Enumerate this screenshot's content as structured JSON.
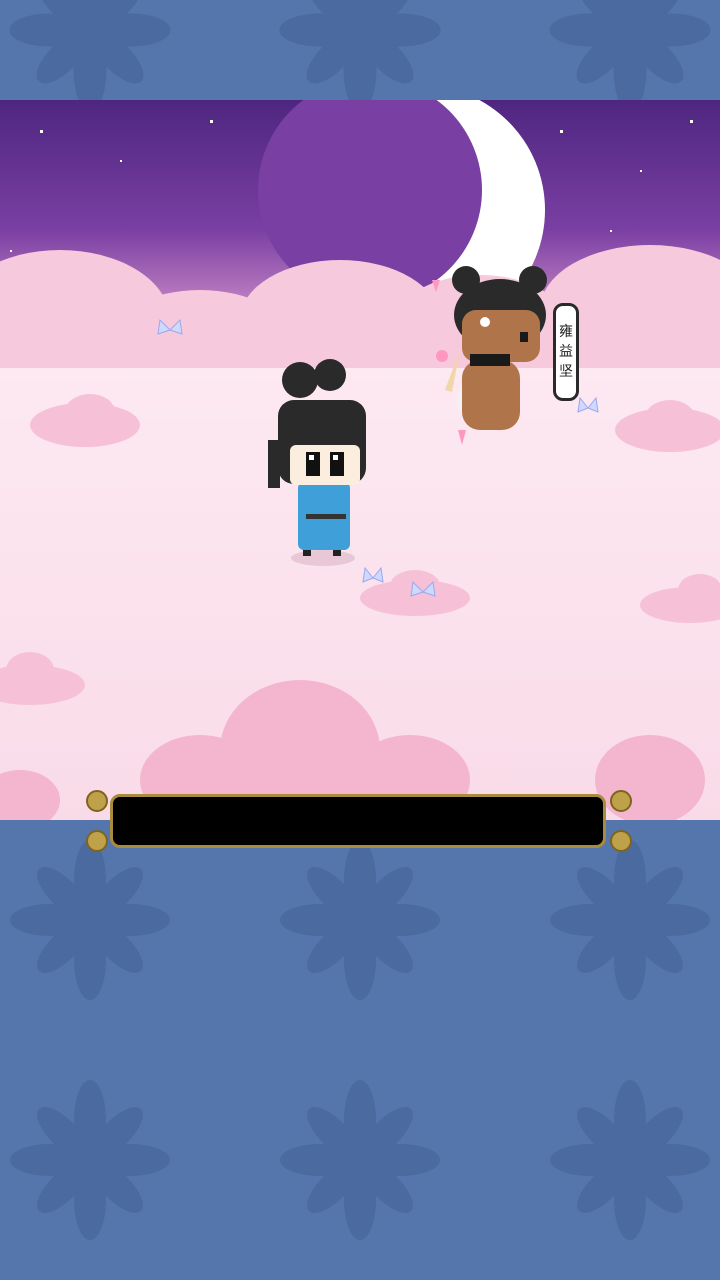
{
  "scene": {
    "title": "",
    "sky_top_color": "#5b2d86",
    "cloud_color": "#f7c9dc",
    "moon": "crescent-moon"
  },
  "npc": {
    "name_chars": [
      "雍",
      "益",
      "坚"
    ],
    "icon": "cupid-npc"
  },
  "player": {
    "icon": "player-character"
  },
  "dialog": {
    "text": ""
  },
  "colors": {
    "frame_blue": "#5476ad",
    "frame_pattern": "#4a6aa0",
    "dialog_border": "#a88b3c"
  }
}
